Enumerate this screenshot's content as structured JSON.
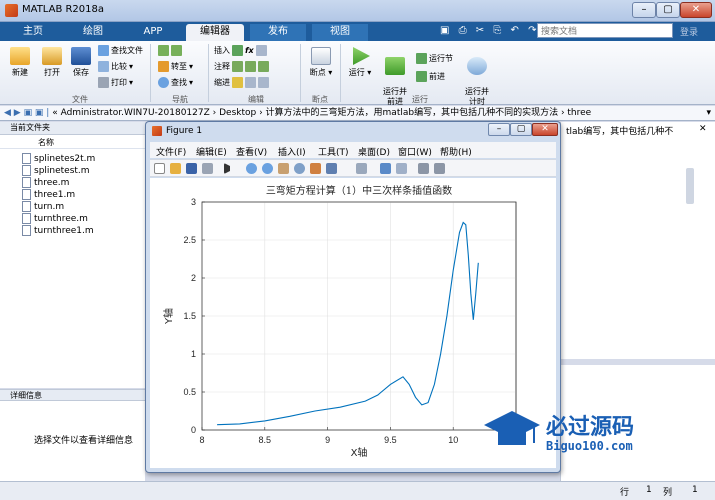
{
  "app": {
    "title": "MATLAB R2018a",
    "help": "登录"
  },
  "tabs": [
    {
      "label": "主页"
    },
    {
      "label": "绘图"
    },
    {
      "label": "APP"
    },
    {
      "label": "编辑器"
    },
    {
      "label": "发布"
    },
    {
      "label": "视图"
    }
  ],
  "search_placeholder": "搜索文档",
  "ribbon": {
    "file": {
      "new": "新建",
      "open": "打开",
      "save": "保存",
      "find_files": "查找文件",
      "compare": "比较",
      "print": "打印",
      "group": "文件"
    },
    "nav": {
      "goto": "转至",
      "find": "查找",
      "group": "导航"
    },
    "edit": {
      "insert": "插入",
      "comment": "注释",
      "indent": "缩进",
      "group": "编辑"
    },
    "breakpoint": {
      "label": "断点",
      "group": "断点"
    },
    "run": {
      "run": "运行",
      "run_advance": "运行并\n前进",
      "run_section": "运行节",
      "advance": "前进",
      "run_time": "运行并\n计时",
      "group": "运行"
    }
  },
  "address": {
    "path": "« Administrator.WIN7U-20180127Z  ›  Desktop  ›  计算方法中的三弯矩方法，用matlab编写，其中包括几种不同的实现方法  ›  three"
  },
  "current_folder": {
    "header": "当前文件夹",
    "column": "名称",
    "files": [
      "splinetes2t.m",
      "splinetest.m",
      "three.m",
      "three1.m",
      "turn.m",
      "turnthree.m",
      "turnthree1.m"
    ]
  },
  "details": {
    "header": "详细信息",
    "message": "选择文件以查看详细信息"
  },
  "right_text": "tlab编写，其中包括几种不",
  "status": {
    "row_label": "行",
    "row": "1",
    "col_label": "列",
    "col": "1"
  },
  "figure": {
    "title": "Figure 1",
    "menu": [
      "文件(F)",
      "编辑(E)",
      "查看(V)",
      "插入(I)",
      "工具(T)",
      "桌面(D)",
      "窗口(W)",
      "帮助(H)"
    ]
  },
  "chart_data": {
    "type": "line",
    "title": "三弯矩方程计算（1）中三次样条插值函数",
    "xlabel": "X轴",
    "ylabel": "Y轴",
    "xlim": [
      8,
      10.5
    ],
    "ylim": [
      0,
      3
    ],
    "xticks": [
      "8",
      "8.5",
      "9",
      "9.5",
      "10"
    ],
    "yticks": [
      "0",
      "0.5",
      "1",
      "1.5",
      "2",
      "2.5",
      "3"
    ],
    "grid": true,
    "series": [
      {
        "color": "#0072bd",
        "x": [
          8.12,
          8.3,
          8.5,
          8.7,
          8.9,
          9.1,
          9.3,
          9.4,
          9.5,
          9.6,
          9.65,
          9.7,
          9.75,
          9.8,
          9.85,
          9.9,
          9.95,
          10.0,
          10.05,
          10.08,
          10.1,
          10.12,
          10.14,
          10.16,
          10.18,
          10.2
        ],
        "y": [
          0.07,
          0.08,
          0.12,
          0.18,
          0.25,
          0.3,
          0.38,
          0.46,
          0.6,
          0.7,
          0.6,
          0.43,
          0.33,
          0.36,
          0.6,
          1.0,
          1.5,
          2.1,
          2.6,
          2.73,
          2.7,
          2.3,
          1.8,
          1.45,
          1.8,
          2.2
        ]
      }
    ]
  },
  "watermark": {
    "name": "必过源码",
    "url": "Biguo100.com"
  }
}
